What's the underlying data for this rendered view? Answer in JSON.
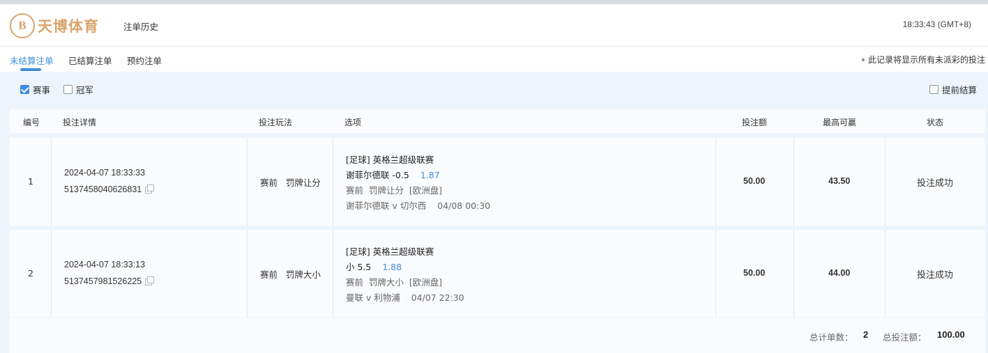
{
  "header": {
    "logo_mark": "B",
    "logo_text": "天博体育",
    "page_title": "注单历史",
    "clock": "18:33:43 (GMT+8)"
  },
  "tabs": [
    {
      "label": "未结算注单",
      "active": true
    },
    {
      "label": "已结算注单",
      "active": false
    },
    {
      "label": "预约注单",
      "active": false
    }
  ],
  "notice": "此记录将显示所有未派彩的投注",
  "filters": {
    "matches": {
      "label": "赛事",
      "checked": true
    },
    "outright": {
      "label": "冠军",
      "checked": false
    },
    "early_cashout": {
      "label": "提前结算",
      "checked": false
    }
  },
  "table": {
    "columns": [
      "编号",
      "投注详情",
      "投注玩法",
      "选项",
      "投注额",
      "最高可赢",
      "状态"
    ],
    "rows": [
      {
        "no": "1",
        "datetime": "2024-04-07 18:33:33",
        "ticket": "5137458040626831",
        "play": "赛前   罚牌让分",
        "league": "[足球] 英格兰超级联赛",
        "selection": "谢菲尔德联 -0.5",
        "odds": "1.87",
        "market": "赛前  罚牌让分  [欧洲盘]",
        "match": "谢菲尔德联 v 切尔西    04/08 00:30",
        "stake": "50.00",
        "max_win": "43.50",
        "status": "投注成功"
      },
      {
        "no": "2",
        "datetime": "2024-04-07 18:33:13",
        "ticket": "5137457981526225",
        "play": "赛前   罚牌大小",
        "league": "[足球] 英格兰超级联赛",
        "selection": "小 5.5",
        "odds": "1.88",
        "market": "赛前  罚牌大小  [欧洲盘]",
        "match": "曼联 v 利物浦    04/07 22:30",
        "stake": "50.00",
        "max_win": "44.00",
        "status": "投注成功"
      }
    ]
  },
  "footer": {
    "count_label": "总计单数：",
    "count_value": "2",
    "total_label": "总投注额：",
    "total_value": "100.00"
  },
  "colors": {
    "accent": "#3c8ddc",
    "brand_gold": "#d8a46d",
    "content_bg": "#eef4fb"
  }
}
